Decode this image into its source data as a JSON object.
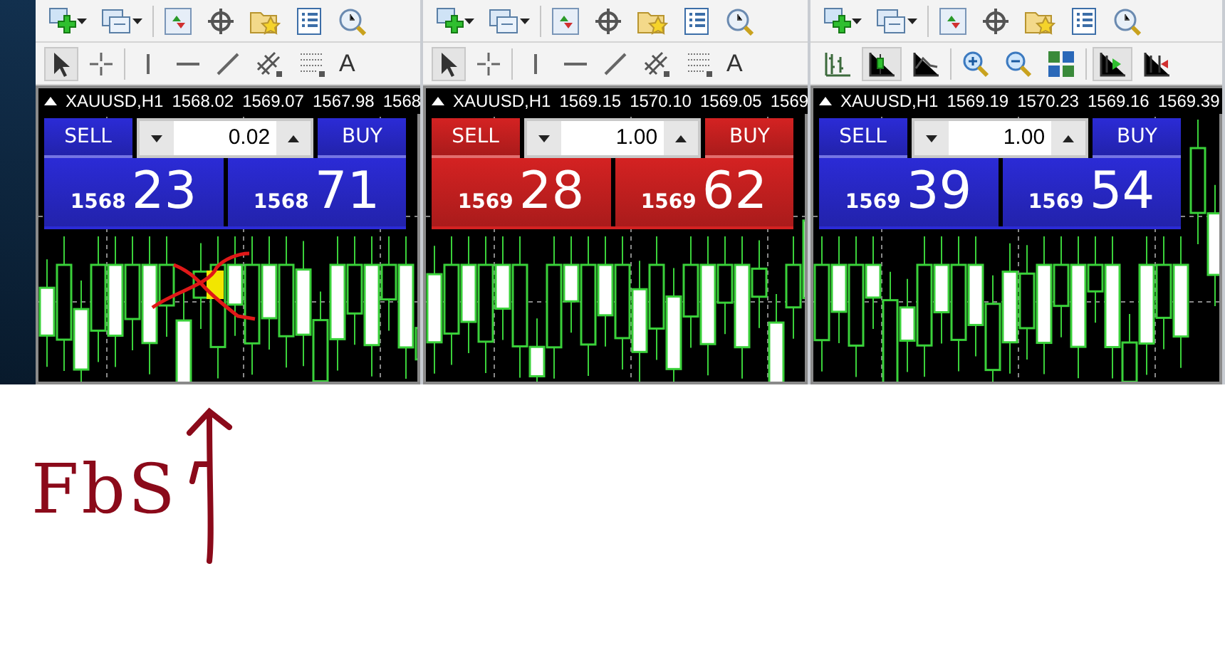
{
  "panels": [
    {
      "kind": "drawing",
      "color": "#2b2bd6",
      "symbol": "XAUUSD,H1",
      "quotes": [
        "1568.02",
        "1569.07",
        "1567.98",
        "1568"
      ],
      "sell_label": "SELL",
      "buy_label": "BUY",
      "volume": "0.02",
      "sell_price": {
        "big_figure": "1568",
        "pips": "23"
      },
      "buy_price": {
        "big_figure": "1568",
        "pips": "71"
      },
      "text_tool": "A",
      "scribble": true
    },
    {
      "kind": "drawing",
      "color": "#d42222",
      "symbol": "XAUUSD,H1",
      "quotes": [
        "1569.15",
        "1570.10",
        "1569.05",
        "1569"
      ],
      "sell_label": "SELL",
      "buy_label": "BUY",
      "volume": "1.00",
      "sell_price": {
        "big_figure": "1569",
        "pips": "28"
      },
      "buy_price": {
        "big_figure": "1569",
        "pips": "62"
      },
      "text_tool": "A",
      "scribble": false
    },
    {
      "kind": "chart",
      "color": "#2b2bd6",
      "symbol": "XAUUSD,H1",
      "quotes": [
        "1569.19",
        "1570.23",
        "1569.16",
        "1569.39"
      ],
      "sell_label": "SELL",
      "buy_label": "BUY",
      "volume": "1.00",
      "sell_price": {
        "big_figure": "1569",
        "pips": "39"
      },
      "buy_price": {
        "big_figure": "1569",
        "pips": "54"
      },
      "scribble": false
    }
  ],
  "note": {
    "text": "FbS"
  }
}
